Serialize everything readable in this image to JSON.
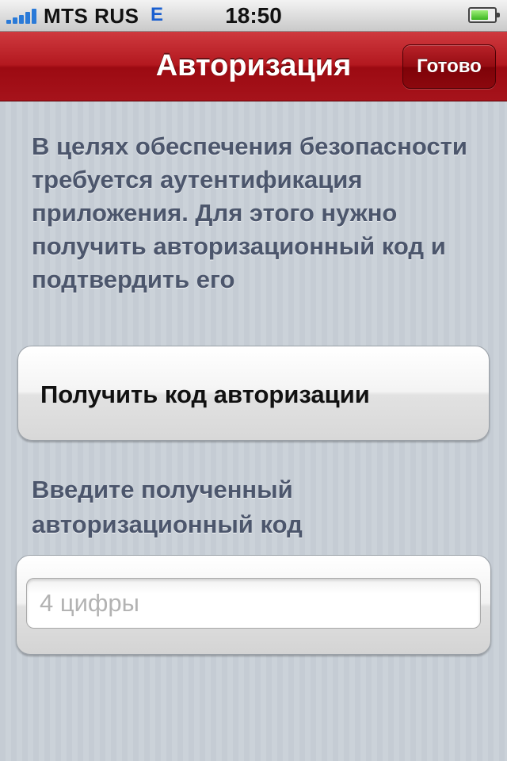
{
  "status_bar": {
    "carrier": "MTS RUS",
    "network": "E",
    "time": "18:50",
    "signal_bars": 5,
    "battery_level": 0.75,
    "signal_color": "#2a7ad8"
  },
  "nav": {
    "title": "Авторизация",
    "done_label": "Готово",
    "bar_color": "#b3181f"
  },
  "main": {
    "intro_text": "В целях обеспечения безопасности требуется аутентификация приложения. Для этого нужно получить авторизационный код и подтвердить его",
    "get_code_label": "Получить код авторизации",
    "enter_code_label": "Введите полученный авторизационный код",
    "code_input": {
      "value": "",
      "placeholder": "4 цифры"
    }
  }
}
